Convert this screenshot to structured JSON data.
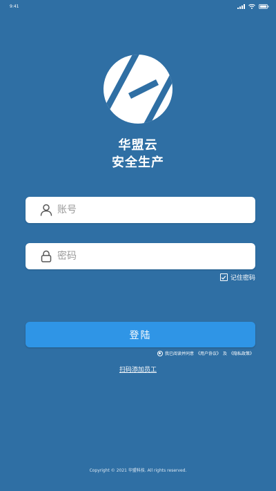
{
  "status_bar": {
    "time": "9:41"
  },
  "app": {
    "title_line1": "华盟云",
    "title_line2": "安全生产"
  },
  "login_form": {
    "username_placeholder": "账号",
    "password_placeholder": "密码",
    "remember_label": "记住密码",
    "remember_checked": true,
    "login_button_label": "登陆",
    "agreement": {
      "prefix": "我已阅读并同意",
      "user_agreement": "《用户协议》",
      "conjunction": "及",
      "privacy_policy": "《隐私政策》",
      "accepted": true
    },
    "scan_link_label": "扫码添加员工"
  },
  "footer": {
    "copyright": "Copyright © 2021 华盟科技. All rights reserved."
  },
  "colors": {
    "background": "#2f6fa4",
    "button": "#2f95e6",
    "field_bg": "#ffffff"
  },
  "icons": {
    "username": "user-icon",
    "password": "lock-icon",
    "remember": "check-icon"
  }
}
